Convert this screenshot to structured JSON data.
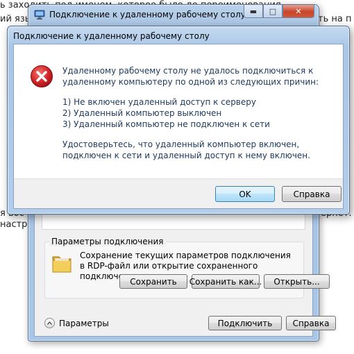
{
  "background": {
    "line1": "ь заходить под именем, которое было до переименования",
    "line2": "ий язы",
    "line2_right": "ть на п",
    "line3": "я вос",
    "line3_right": "ернет.",
    "line4": "настр"
  },
  "rdp_window": {
    "title": "Подключение к удаленному рабочему столу",
    "app_icon": "remote-desktop-icon",
    "params_group": {
      "legend": "Параметры подключения",
      "description": "Сохранение текущих параметров подключения в RDP-файл или открытие сохраненного подключения.",
      "icon": "folder-icon",
      "save_button": "Сохранить",
      "save_as_button": "Сохранить как...",
      "open_button": "Открыть..."
    },
    "options_toggle": "Параметры",
    "connect_button": "Подключить",
    "help_button": "Справка"
  },
  "error_dialog": {
    "title": "Подключение к удаленному рабочему столу",
    "icon": "error-icon",
    "message": "Удаленному рабочему столу не удалось подключиться к удаленному компьютеру по одной из следующих причин:",
    "reasons": [
      "1) Не включен удаленный доступ к серверу",
      "2) Удаленный компьютер выключен",
      "3) Удаленный компьютер не подключен к сети"
    ],
    "advice": "Удостоверьтесь, что удаленный компьютер включен, подключен к сети и удаленный доступ к нему включен.",
    "ok_button": "OK",
    "help_button": "Справка"
  },
  "colors": {
    "message_text": "#1e395b",
    "error_red": "#c4171d",
    "titlebar": "#b9d1ea",
    "close_button": "#c7452c"
  }
}
